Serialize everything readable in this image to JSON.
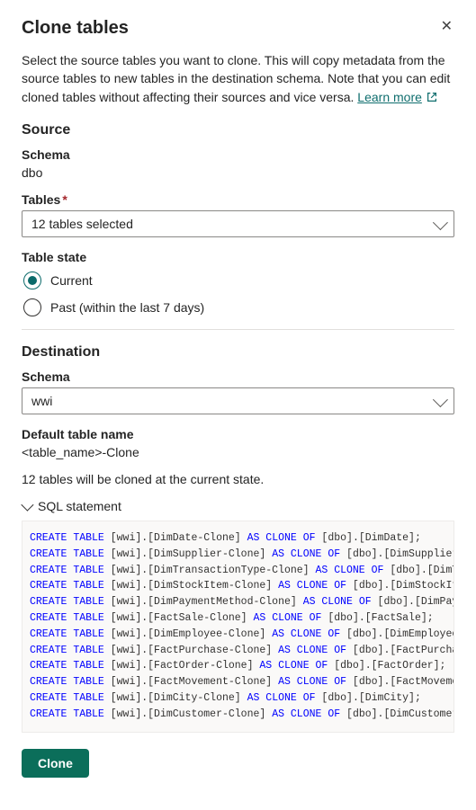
{
  "title": "Clone tables",
  "intro": "Select the source tables you want to clone. This will copy metadata from the source tables to new tables in the destination schema. Note that you can edit cloned tables without affecting their sources and vice versa. ",
  "learn_more": "Learn more",
  "source": {
    "heading": "Source",
    "schema_label": "Schema",
    "schema_value": "dbo",
    "tables_label": "Tables",
    "tables_selected": "12 tables selected",
    "table_state_label": "Table state",
    "radio_current": "Current",
    "radio_past": "Past (within the last 7 days)"
  },
  "destination": {
    "heading": "Destination",
    "schema_label": "Schema",
    "schema_value": "wwi",
    "default_name_label": "Default table name",
    "default_name_value": "<table_name>-Clone"
  },
  "status_line": "12 tables will be cloned at the current state.",
  "sql_header": "SQL statement",
  "sql": {
    "kw_create": "CREATE",
    "kw_table": "TABLE",
    "kw_as": "AS",
    "kw_clone": "CLONE",
    "kw_of": "OF",
    "dest_schema": "[wwi]",
    "src_schema": "[dbo]",
    "rows": [
      {
        "dest": "[DimDate-Clone]",
        "src": "[DimDate]"
      },
      {
        "dest": "[DimSupplier-Clone]",
        "src": "[DimSupplier]"
      },
      {
        "dest": "[DimTransactionType-Clone]",
        "src": "[DimTra"
      },
      {
        "dest": "[DimStockItem-Clone]",
        "src": "[DimStockItem"
      },
      {
        "dest": "[DimPaymentMethod-Clone]",
        "src": "[DimPayme"
      },
      {
        "dest": "[FactSale-Clone]",
        "src": "[FactSale]"
      },
      {
        "dest": "[DimEmployee-Clone]",
        "src": "[DimEmployee]"
      },
      {
        "dest": "[FactPurchase-Clone]",
        "src": "[FactPurchase"
      },
      {
        "dest": "[FactOrder-Clone]",
        "src": "[FactOrder]"
      },
      {
        "dest": "[FactMovement-Clone]",
        "src": "[FactMovement"
      },
      {
        "dest": "[DimCity-Clone]",
        "src": "[DimCity]"
      },
      {
        "dest": "[DimCustomer-Clone]",
        "src": "[DimCustomer]"
      }
    ]
  },
  "clone_button": "Clone"
}
